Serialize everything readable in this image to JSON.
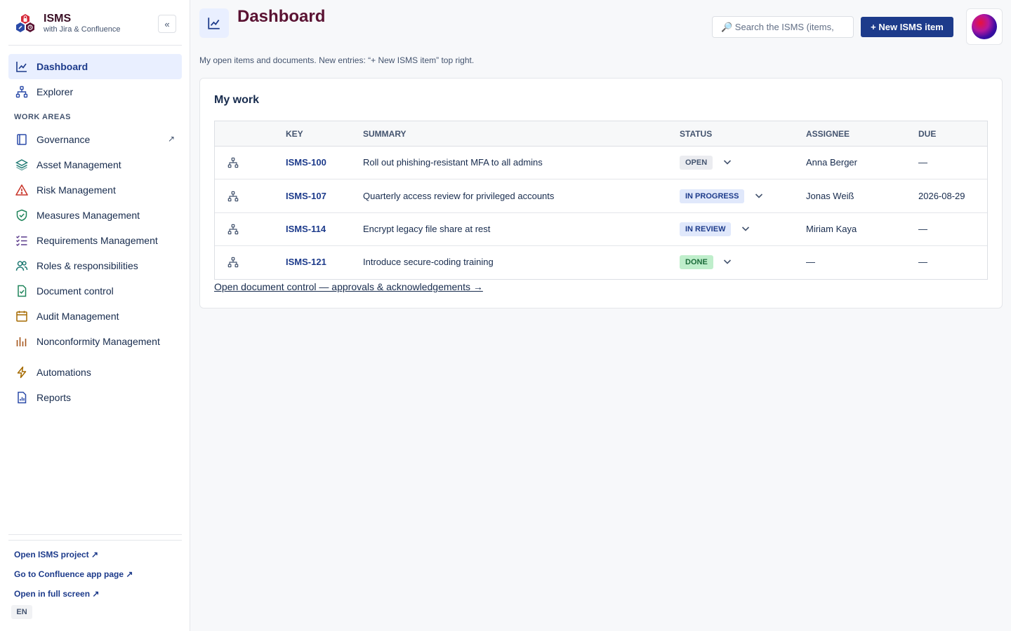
{
  "brand": {
    "title": "ISMS",
    "subtitle": "with Jira & Confluence",
    "collapse_label": "«"
  },
  "sidebar": {
    "primary": [
      {
        "label": "Dashboard",
        "icon": "chart-line-icon",
        "active": true
      },
      {
        "label": "Explorer",
        "icon": "hierarchy-icon"
      }
    ],
    "section_label": "WORK AREAS",
    "work_areas": [
      {
        "label": "Governance",
        "icon": "book-icon",
        "external": "↗"
      },
      {
        "label": "Asset Management",
        "icon": "layers-icon"
      },
      {
        "label": "Risk Management",
        "icon": "warning-icon"
      },
      {
        "label": "Measures Management",
        "icon": "shield-check-icon"
      },
      {
        "label": "Requirements Management",
        "icon": "checklist-icon"
      },
      {
        "label": "Roles & responsibilities",
        "icon": "people-icon"
      },
      {
        "label": "Document control",
        "icon": "document-check-icon"
      },
      {
        "label": "Audit Management",
        "icon": "calendar-icon"
      },
      {
        "label": "Nonconformity Management",
        "icon": "bar-chart-icon"
      }
    ],
    "tools": [
      {
        "label": "Automations",
        "icon": "lightning-icon"
      },
      {
        "label": "Reports",
        "icon": "report-icon"
      }
    ],
    "footer": {
      "open_project": "Open ISMS project ↗",
      "confluence": "Go to Confluence app page ↗",
      "full_screen": "Open in full screen ↗",
      "language": "EN"
    }
  },
  "header": {
    "title": "Dashboard",
    "search_placeholder": "🔎 Search the ISMS (items,",
    "new_button": "+ New ISMS item",
    "intro": "My open items and documents. New entries: “+ New ISMS item” top right."
  },
  "my_work": {
    "title": "My work",
    "columns": {
      "key": "KEY",
      "summary": "SUMMARY",
      "status": "STATUS",
      "assignee": "ASSIGNEE",
      "due": "DUE"
    },
    "rows": [
      {
        "key": "ISMS-100",
        "summary": "Roll out phishing-resistant MFA to all admins",
        "status": "OPEN",
        "assignee": "Anna Berger",
        "due": "—"
      },
      {
        "key": "ISMS-107",
        "summary": "Quarterly access review for privileged accounts",
        "status": "IN PROGRESS",
        "assignee": "Jonas Weiß",
        "due": "2026-08-29"
      },
      {
        "key": "ISMS-114",
        "summary": "Encrypt legacy file share at rest",
        "status": "IN REVIEW",
        "assignee": "Miriam Kaya",
        "due": "—"
      },
      {
        "key": "ISMS-121",
        "summary": "Introduce secure-coding training",
        "status": "DONE",
        "assignee": "—",
        "due": "—"
      }
    ],
    "doc_link": "Open document control — approvals & acknowledgements →"
  },
  "colors": {
    "accent": "#1d3b8b",
    "title": "#5a1232",
    "status_open": "#ebecf0",
    "status_progress": "#e0e8fb",
    "status_done": "#bfeecb"
  }
}
